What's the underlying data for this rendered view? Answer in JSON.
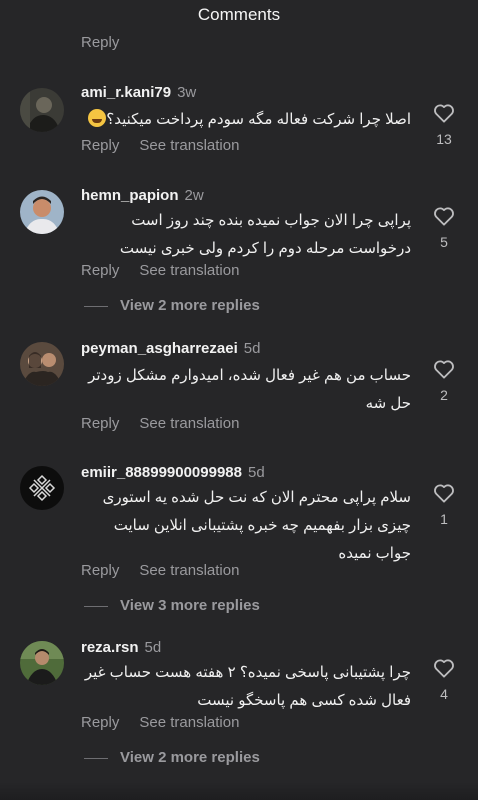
{
  "header": {
    "title": "Comments"
  },
  "top_reply": "Reply",
  "actions": {
    "reply": "Reply",
    "translate": "See translation"
  },
  "comments": [
    {
      "username": "ami_r.kani79",
      "time": "3w",
      "text": "اصلا چرا شرکت فعاله مگه سودم پرداخت میکنید؟",
      "likes": "13",
      "more_replies": ""
    },
    {
      "username": "hemn_papion",
      "time": "2w",
      "text": "پراپی چرا الان جواب نمیده بنده چند روز است درخواست مرحله دوم را کردم ولی خبری نیست",
      "likes": "5",
      "more_replies": "View 2 more replies"
    },
    {
      "username": "peyman_asgharrezaei",
      "time": "5d",
      "text": "حساب من هم غیر فعال شده، امیدوارم مشکل زودتر حل شه",
      "likes": "2",
      "more_replies": ""
    },
    {
      "username": "emiir_88899900099988",
      "time": "5d",
      "text": "سلام پراپی محترم الان که نت حل شده یه استوری چیزی بزار بفهمیم چه خبره پشتیبانی انلاین سایت جواب نمیده",
      "likes": "1",
      "more_replies": "View 3 more replies"
    },
    {
      "username": "reza.rsn",
      "time": "5d",
      "text": "چرا پشتیبانی پاسخی نمیده؟ ۲ هفته هست حساب غیر فعال شده کسی هم پاسخگو نیست",
      "likes": "4",
      "more_replies": "View 2 more replies"
    }
  ],
  "icons": {
    "like": "heart-outline-icon",
    "emoji": "laughing-emoji-icon"
  }
}
